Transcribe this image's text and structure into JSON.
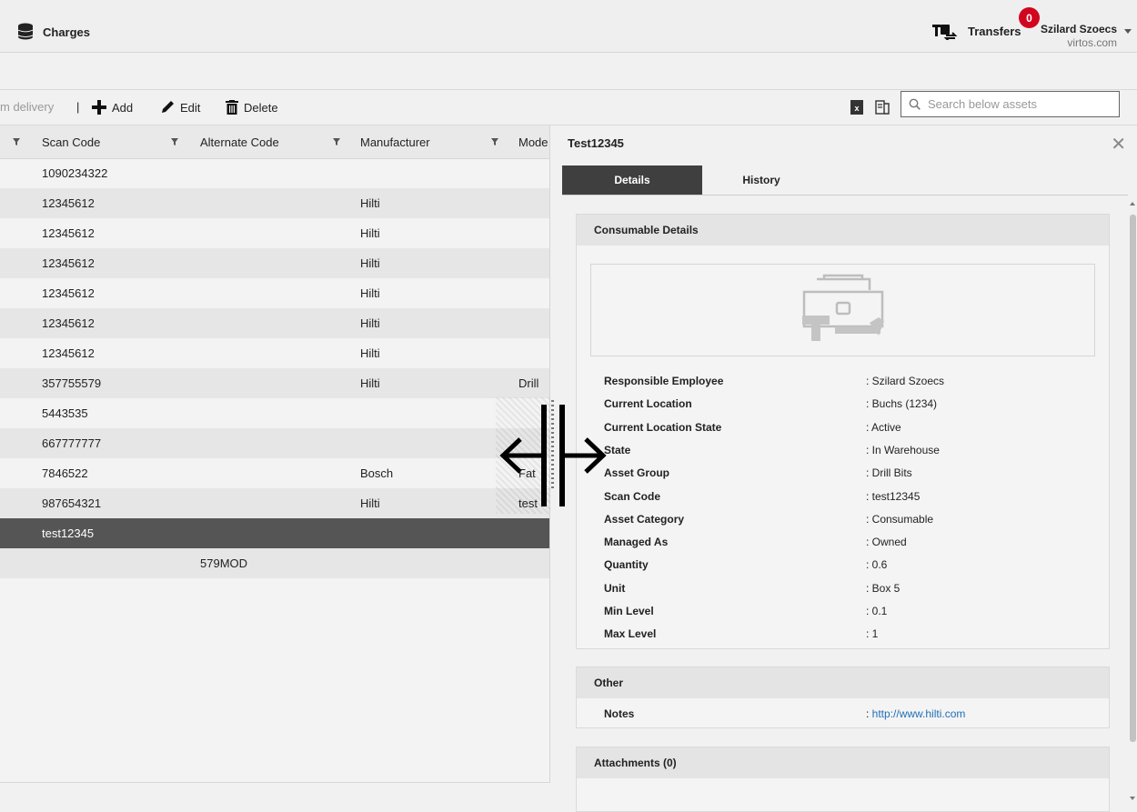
{
  "topbar": {
    "section_label": "Charges",
    "transfers_label": "Transfers",
    "transfers_badge": "0",
    "user_name": "Szilard Szoecs",
    "user_domain": "virtos.com"
  },
  "toolbar": {
    "truncated_label": "m delivery",
    "separator": "|",
    "add_label": "Add",
    "edit_label": "Edit",
    "delete_label": "Delete",
    "search_placeholder": "Search below assets"
  },
  "table": {
    "columns": [
      "Scan Code",
      "Alternate Code",
      "Manufacturer",
      "Mode"
    ],
    "rows": [
      {
        "scan_code": "1090234322",
        "alternate_code": "",
        "manufacturer": "",
        "model": ""
      },
      {
        "scan_code": "12345612",
        "alternate_code": "",
        "manufacturer": "Hilti",
        "model": ""
      },
      {
        "scan_code": "12345612",
        "alternate_code": "",
        "manufacturer": "Hilti",
        "model": ""
      },
      {
        "scan_code": "12345612",
        "alternate_code": "",
        "manufacturer": "Hilti",
        "model": ""
      },
      {
        "scan_code": "12345612",
        "alternate_code": "",
        "manufacturer": "Hilti",
        "model": ""
      },
      {
        "scan_code": "12345612",
        "alternate_code": "",
        "manufacturer": "Hilti",
        "model": ""
      },
      {
        "scan_code": "12345612",
        "alternate_code": "",
        "manufacturer": "Hilti",
        "model": ""
      },
      {
        "scan_code": "357755579",
        "alternate_code": "",
        "manufacturer": "Hilti",
        "model": "Drill"
      },
      {
        "scan_code": "5443535",
        "alternate_code": "",
        "manufacturer": "",
        "model": ""
      },
      {
        "scan_code": "667777777",
        "alternate_code": "",
        "manufacturer": "",
        "model": ""
      },
      {
        "scan_code": "7846522",
        "alternate_code": "",
        "manufacturer": "Bosch",
        "model": "Fat"
      },
      {
        "scan_code": "987654321",
        "alternate_code": "",
        "manufacturer": "Hilti",
        "model": "test"
      },
      {
        "scan_code": "test12345",
        "alternate_code": "",
        "manufacturer": "",
        "model": ""
      },
      {
        "scan_code": "",
        "alternate_code": "579MOD",
        "manufacturer": "",
        "model": ""
      }
    ],
    "selected_index": 12
  },
  "panel": {
    "title": "Test12345",
    "tabs": [
      "Details",
      "History"
    ],
    "active_tab": "Details",
    "consumable_header": "Consumable Details",
    "details": [
      {
        "label": "Responsible Employee",
        "value": ": Szilard Szoecs"
      },
      {
        "label": "Current Location",
        "value": ": Buchs (1234)"
      },
      {
        "label": "Current Location State",
        "value": ": Active"
      },
      {
        "label": "State",
        "value": ": In Warehouse"
      },
      {
        "label": "Asset Group",
        "value": ": Drill Bits"
      },
      {
        "label": "Scan Code",
        "value": ": test12345"
      },
      {
        "label": "Asset Category",
        "value": ": Consumable"
      },
      {
        "label": "Managed As",
        "value": ": Owned"
      },
      {
        "label": "Quantity",
        "value": ": 0.6"
      },
      {
        "label": "Unit",
        "value": ": Box 5"
      },
      {
        "label": "Min Level",
        "value": ": 0.1"
      },
      {
        "label": "Max Level",
        "value": ": 1"
      }
    ],
    "other_header": "Other",
    "notes_label": "Notes",
    "notes_prefix": ": ",
    "notes_link": "http://www.hilti.com",
    "attachments_header": "Attachments (0)"
  },
  "colors": {
    "badge": "#d2051e",
    "selected_row": "#555555",
    "active_tab": "#3f3f3f",
    "link": "#1f6fb5"
  },
  "icons": [
    "database-icon",
    "transfers-icon",
    "add-icon",
    "edit-icon",
    "delete-icon",
    "excel-export-icon",
    "columns-icon",
    "search-icon",
    "filter-icon",
    "close-icon",
    "toolbox-placeholder-icon",
    "resize-arrows-icon"
  ]
}
